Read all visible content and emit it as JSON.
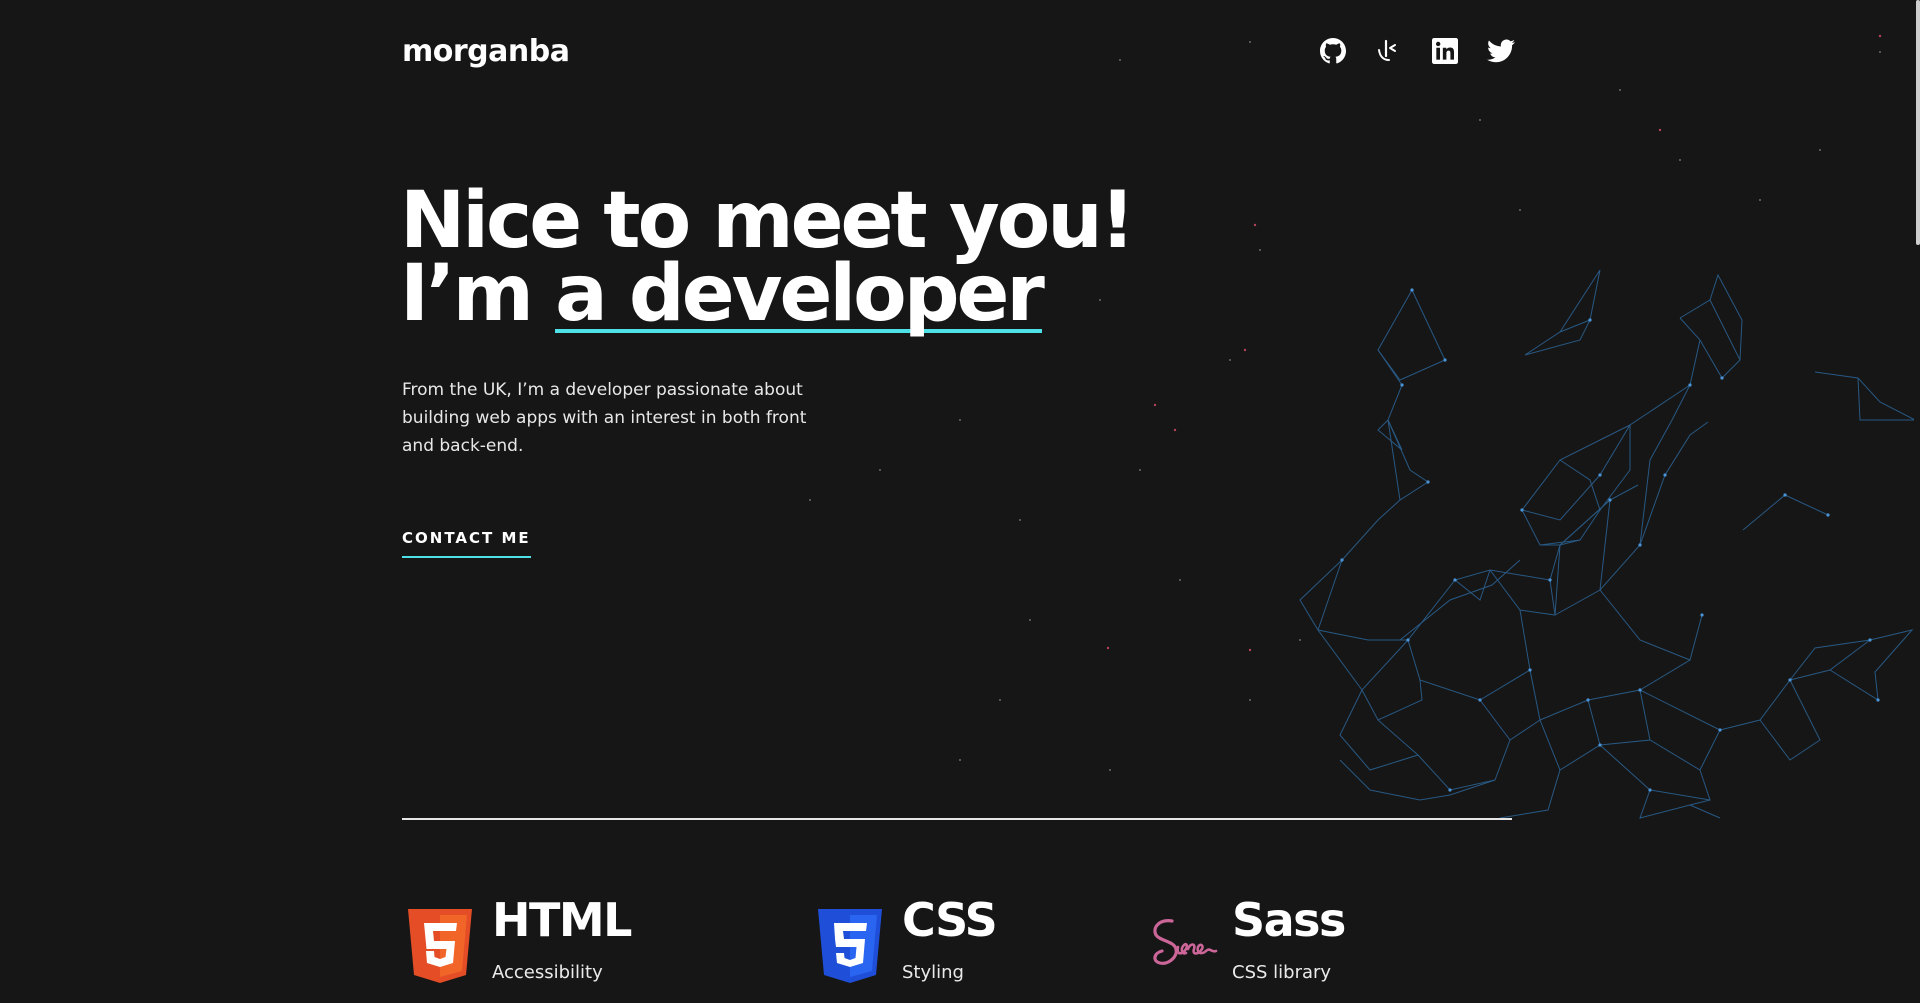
{
  "header": {
    "logo": "morganba",
    "social": [
      {
        "name": "github",
        "icon": "github-icon"
      },
      {
        "name": "frontend-mentor",
        "icon": "frontend-mentor-icon"
      },
      {
        "name": "linkedin",
        "icon": "linkedin-icon"
      },
      {
        "name": "twitter",
        "icon": "twitter-icon"
      }
    ]
  },
  "hero": {
    "title_line1": "Nice to meet you!",
    "title_line2_prefix": "I’m ",
    "title_line2_highlight": "a developer",
    "intro": "From the UK, I’m a developer passionate about building web apps with an interest in both front and back-end.",
    "cta": "CONTACT ME"
  },
  "skills": [
    {
      "name": "HTML",
      "desc": "Accessibility",
      "icon": "html5-icon"
    },
    {
      "name": "CSS",
      "desc": "Styling",
      "icon": "css3-icon"
    },
    {
      "name": "Sass",
      "desc": "CSS library",
      "icon": "sass-icon"
    }
  ],
  "colors": {
    "background": "#161616",
    "accent": "#4ee1e8",
    "html": "#e44d26",
    "css": "#1572b6",
    "sass": "#cc6699",
    "network": "#3b82c4"
  }
}
